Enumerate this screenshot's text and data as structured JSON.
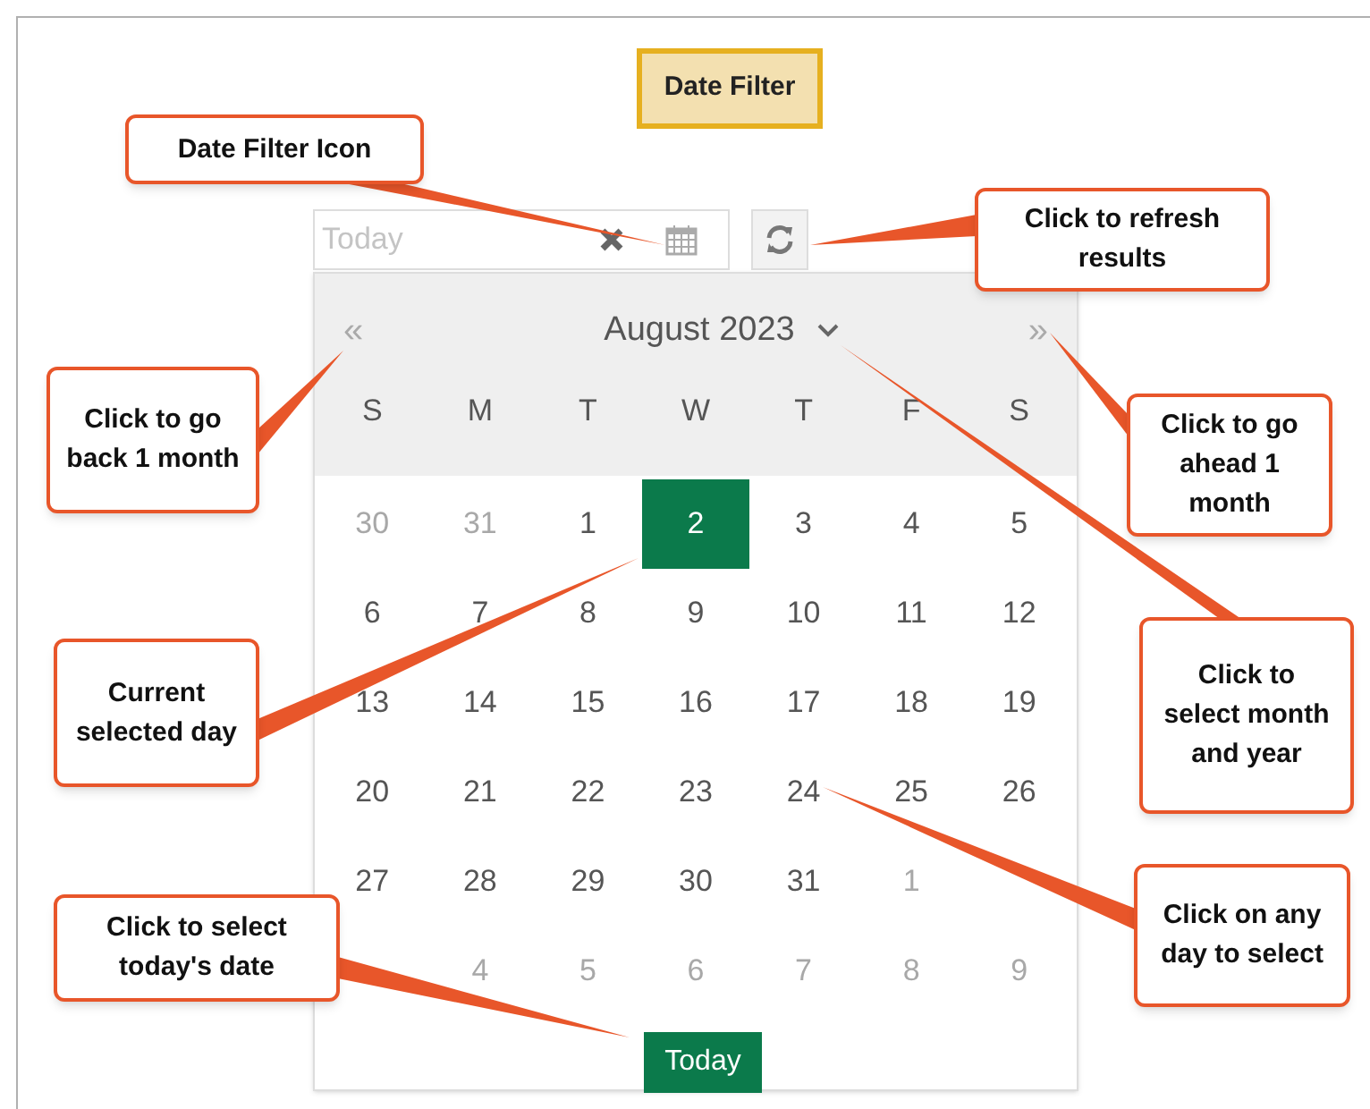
{
  "title": "Date Filter",
  "date_field": {
    "placeholder": "Today"
  },
  "calendar": {
    "month_label": "August 2023",
    "prev": "«",
    "next": "»",
    "weekdays": [
      "S",
      "M",
      "T",
      "W",
      "T",
      "F",
      "S"
    ],
    "days": [
      {
        "kind": "day",
        "label": "30",
        "muted": true,
        "selected": false
      },
      {
        "kind": "day",
        "label": "31",
        "muted": true,
        "selected": false
      },
      {
        "kind": "day",
        "label": "1",
        "muted": false,
        "selected": false
      },
      {
        "kind": "day",
        "label": "2",
        "muted": false,
        "selected": true
      },
      {
        "kind": "day",
        "label": "3",
        "muted": false,
        "selected": false
      },
      {
        "kind": "day",
        "label": "4",
        "muted": false,
        "selected": false
      },
      {
        "kind": "day",
        "label": "5",
        "muted": false,
        "selected": false
      },
      {
        "kind": "day",
        "label": "6",
        "muted": false,
        "selected": false
      },
      {
        "kind": "day",
        "label": "7",
        "muted": false,
        "selected": false
      },
      {
        "kind": "day",
        "label": "8",
        "muted": false,
        "selected": false
      },
      {
        "kind": "day",
        "label": "9",
        "muted": false,
        "selected": false
      },
      {
        "kind": "day",
        "label": "10",
        "muted": false,
        "selected": false
      },
      {
        "kind": "day",
        "label": "11",
        "muted": false,
        "selected": false
      },
      {
        "kind": "day",
        "label": "12",
        "muted": false,
        "selected": false
      },
      {
        "kind": "day",
        "label": "13",
        "muted": false,
        "selected": false
      },
      {
        "kind": "day",
        "label": "14",
        "muted": false,
        "selected": false
      },
      {
        "kind": "day",
        "label": "15",
        "muted": false,
        "selected": false
      },
      {
        "kind": "day",
        "label": "16",
        "muted": false,
        "selected": false
      },
      {
        "kind": "day",
        "label": "17",
        "muted": false,
        "selected": false
      },
      {
        "kind": "day",
        "label": "18",
        "muted": false,
        "selected": false
      },
      {
        "kind": "day",
        "label": "19",
        "muted": false,
        "selected": false
      },
      {
        "kind": "day",
        "label": "20",
        "muted": false,
        "selected": false
      },
      {
        "kind": "day",
        "label": "21",
        "muted": false,
        "selected": false
      },
      {
        "kind": "day",
        "label": "22",
        "muted": false,
        "selected": false
      },
      {
        "kind": "day",
        "label": "23",
        "muted": false,
        "selected": false
      },
      {
        "kind": "day",
        "label": "24",
        "muted": false,
        "selected": false
      },
      {
        "kind": "day",
        "label": "25",
        "muted": false,
        "selected": false
      },
      {
        "kind": "day",
        "label": "26",
        "muted": false,
        "selected": false
      },
      {
        "kind": "day",
        "label": "27",
        "muted": false,
        "selected": false
      },
      {
        "kind": "day",
        "label": "28",
        "muted": false,
        "selected": false
      },
      {
        "kind": "day",
        "label": "29",
        "muted": false,
        "selected": false
      },
      {
        "kind": "day",
        "label": "30",
        "muted": false,
        "selected": false
      },
      {
        "kind": "day",
        "label": "31",
        "muted": false,
        "selected": false
      },
      {
        "kind": "day",
        "label": "1",
        "muted": true,
        "selected": false
      },
      {
        "kind": "covered"
      },
      {
        "kind": "covered"
      },
      {
        "kind": "day",
        "label": "4",
        "muted": true,
        "selected": false
      },
      {
        "kind": "day",
        "label": "5",
        "muted": true,
        "selected": false
      },
      {
        "kind": "day",
        "label": "6",
        "muted": true,
        "selected": false
      },
      {
        "kind": "day",
        "label": "7",
        "muted": true,
        "selected": false
      },
      {
        "kind": "day",
        "label": "8",
        "muted": true,
        "selected": false
      },
      {
        "kind": "day",
        "label": "9",
        "muted": true,
        "selected": false
      }
    ],
    "today_button": "Today"
  },
  "callouts": [
    {
      "kind": "date-filter-icon",
      "text": "Date Filter Icon"
    },
    {
      "kind": "refresh",
      "text": "Click to refresh results"
    },
    {
      "kind": "back",
      "text": "Click to go back 1 month"
    },
    {
      "kind": "ahead",
      "text": "Click to go ahead 1 month"
    },
    {
      "kind": "current-day",
      "text": "Current selected day"
    },
    {
      "kind": "month-year",
      "text": "Click to select month and year"
    },
    {
      "kind": "today",
      "text": "Click to select today's date"
    },
    {
      "kind": "any-day",
      "text": "Click on any day to select"
    }
  ]
}
